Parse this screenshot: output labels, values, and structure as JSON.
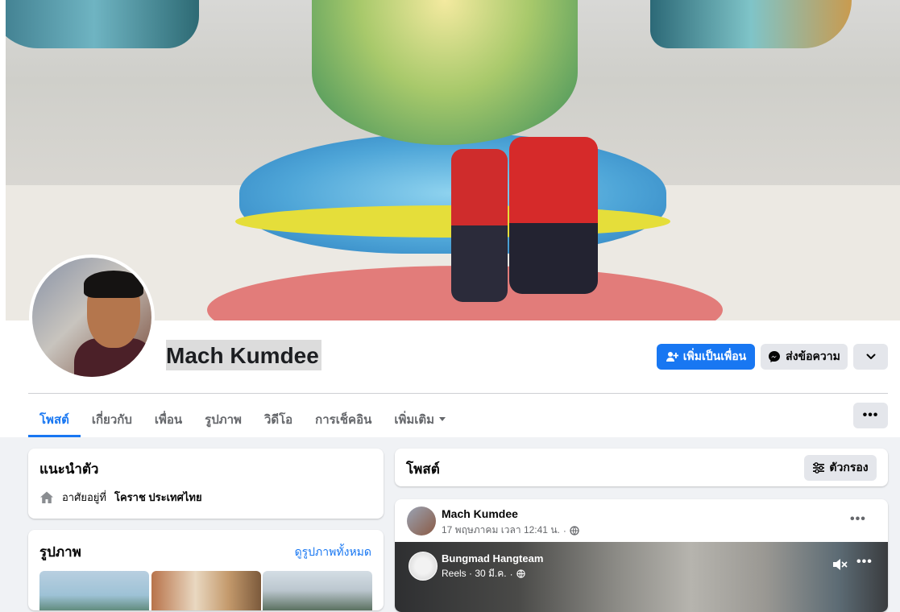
{
  "profile": {
    "name": "Mach Kumdee"
  },
  "actions": {
    "add_friend_label": "เพิ่มเป็นเพื่อน",
    "message_label": "ส่งข้อความ"
  },
  "tabs": [
    {
      "label": "โพสต์",
      "active": true
    },
    {
      "label": "เกี่ยวกับ",
      "active": false
    },
    {
      "label": "เพื่อน",
      "active": false
    },
    {
      "label": "รูปภาพ",
      "active": false
    },
    {
      "label": "วิดีโอ",
      "active": false
    },
    {
      "label": "การเช็คอิน",
      "active": false
    },
    {
      "label": "เพิ่มเติม",
      "active": false
    }
  ],
  "intro": {
    "title": "แนะนำตัว",
    "lives_prefix": "อาศัยอยู่ที่",
    "lives_place": "โคราช ประเทศไทย"
  },
  "photos": {
    "title": "รูปภาพ",
    "see_all": "ดูรูปภาพทั้งหมด"
  },
  "posts": {
    "title": "โพสต์",
    "filter_label": "ตัวกรอง"
  },
  "post": {
    "author": "Mach Kumdee",
    "timestamp": "17 พฤษภาคม เวลา 12:41 น.",
    "separator": "·",
    "reel": {
      "author": "Bungmad Hangteam",
      "meta": "Reels · 30 มี.ค.",
      "separator": "·"
    }
  },
  "colors": {
    "accent": "#1877f2",
    "page_bg": "#f0f2f5",
    "card_bg": "#ffffff",
    "secondary_button": "#e4e6eb",
    "muted_text": "#65676b"
  },
  "icons": [
    "add-friend-icon",
    "messenger-icon",
    "chevron-down-icon",
    "more-icon",
    "home-icon",
    "filter-icon",
    "globe-icon",
    "mute-icon"
  ]
}
